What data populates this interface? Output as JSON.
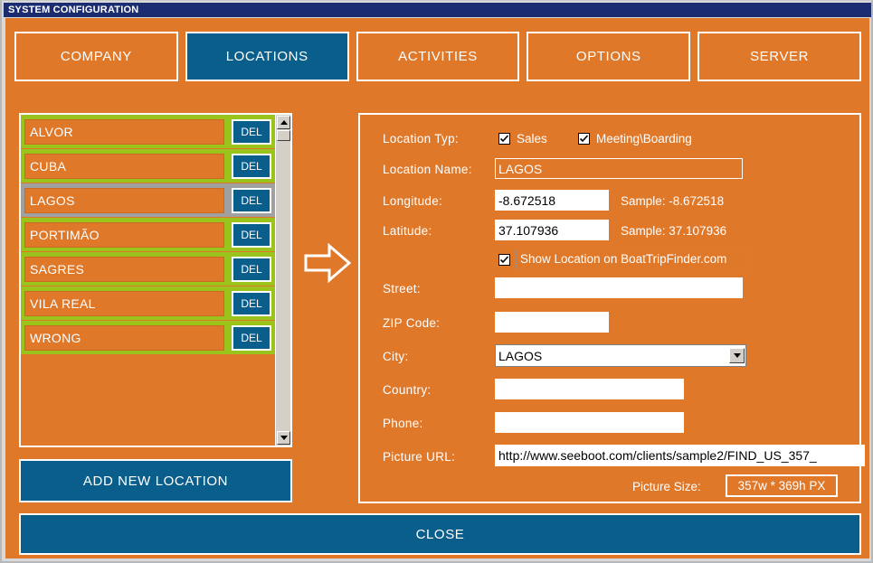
{
  "window": {
    "title": "SYSTEM CONFIGURATION"
  },
  "colors": {
    "titlebar": "#1b2d70",
    "background": "#e0782a",
    "accent_blue": "#0a5e8c",
    "row_green": "#9ac31c",
    "row_selected_gray": "#a0a0a0",
    "white": "#ffffff"
  },
  "tabs": [
    {
      "label": "COMPANY",
      "active": false
    },
    {
      "label": "LOCATIONS",
      "active": true
    },
    {
      "label": "ACTIVITIES",
      "active": false
    },
    {
      "label": "OPTIONS",
      "active": false
    },
    {
      "label": "SERVER",
      "active": false
    }
  ],
  "location_list": {
    "delete_label": "DEL",
    "items": [
      {
        "name": "ALVOR",
        "selected": false
      },
      {
        "name": "CUBA",
        "selected": false
      },
      {
        "name": "LAGOS",
        "selected": true
      },
      {
        "name": "PORTIMÃO",
        "selected": false
      },
      {
        "name": "SAGRES",
        "selected": false
      },
      {
        "name": "VILA REAL",
        "selected": false
      },
      {
        "name": "WRONG",
        "selected": false
      }
    ],
    "add_button": "ADD NEW LOCATION"
  },
  "form": {
    "location_type_label": "Location Typ:",
    "sales_label": "Sales",
    "sales_checked": true,
    "meeting_label": "Meeting\\Boarding",
    "meeting_checked": true,
    "location_name_label": "Location Name:",
    "location_name_value": "LAGOS",
    "longitude_label": "Longitude:",
    "longitude_value": "-8.672518",
    "longitude_sample": "Sample: -8.672518",
    "latitude_label": "Latitude:",
    "latitude_value": "37.107936",
    "latitude_sample": "Sample: 37.107936",
    "show_location_label": "Show Location on BoatTripFinder.com",
    "show_location_checked": true,
    "street_label": "Street:",
    "street_value": "",
    "zip_label": "ZIP Code:",
    "zip_value": "",
    "city_label": "City:",
    "city_value": "LAGOS",
    "country_label": "Country:",
    "country_value": "",
    "phone_label": "Phone:",
    "phone_value": "",
    "picture_url_label": "Picture URL:",
    "picture_url_value": "http://www.seeboot.com/clients/sample2/FIND_US_357_",
    "picture_size_label": "Picture Size:",
    "picture_size_value": "357w * 369h PX"
  },
  "footer": {
    "close_label": "CLOSE"
  }
}
